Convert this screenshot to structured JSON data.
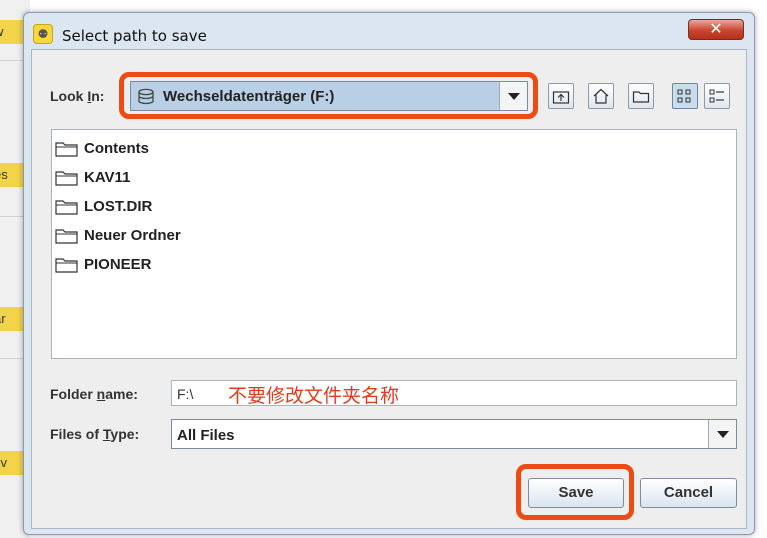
{
  "background": {
    "fragments": [
      "w",
      "es",
      "ar",
      "l v"
    ]
  },
  "window": {
    "title": "Select path to save",
    "app_icon_glyph": "⚉",
    "close_glyph": "✕"
  },
  "look_in": {
    "label_prefix": "Look ",
    "label_mnemonic": "I",
    "label_suffix": "n:",
    "value": "Wechseldatenträger (F:)"
  },
  "toolbar": {
    "icons": [
      "up-one-level-icon",
      "home-icon",
      "new-folder-icon",
      "list-view-icon",
      "details-view-icon"
    ]
  },
  "files": [
    {
      "name": "Contents"
    },
    {
      "name": "KAV11"
    },
    {
      "name": "LOST.DIR"
    },
    {
      "name": "Neuer Ordner"
    },
    {
      "name": "PIONEER"
    }
  ],
  "folder_name": {
    "label_prefix": "Folder ",
    "label_mnemonic": "n",
    "label_suffix": "ame:",
    "value": "F:\\",
    "annotation": "不要修改文件夹名称"
  },
  "files_of_type": {
    "label_prefix": "Files of ",
    "label_mnemonic": "T",
    "label_suffix": "ype:",
    "value": "All Files"
  },
  "buttons": {
    "save": "Save",
    "cancel": "Cancel"
  },
  "colors": {
    "highlight": "#ee4a13",
    "annotation": "#e23b1c",
    "title_bar": "#dbe6f1"
  }
}
